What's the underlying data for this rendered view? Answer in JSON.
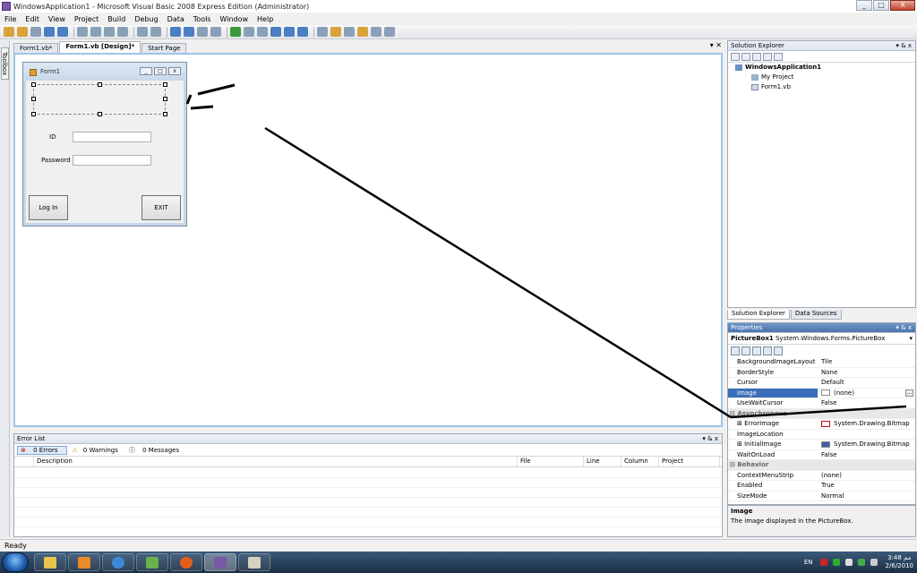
{
  "window": {
    "title": "WindowsApplication1 - Microsoft Visual Basic 2008 Express Edition (Administrator)",
    "controls": [
      "_",
      "□",
      "X"
    ]
  },
  "menu": [
    "File",
    "Edit",
    "View",
    "Project",
    "Build",
    "Debug",
    "Data",
    "Tools",
    "Window",
    "Help"
  ],
  "toolbox": {
    "label": "Toolbox"
  },
  "doc_tabs": [
    {
      "label": "Form1.vb*",
      "active": false
    },
    {
      "label": "Form1.vb [Design]*",
      "active": true
    },
    {
      "label": "Start Page",
      "active": false
    }
  ],
  "doc_tab_controls": "▾ ✕",
  "form": {
    "title": "Form1",
    "id_label": "ID",
    "password_label": "Password",
    "login_button": "Log In",
    "exit_button": "EXIT"
  },
  "solution_explorer": {
    "title": "Solution Explorer",
    "controls": "▾ & x",
    "items": [
      {
        "label": "WindowsApplication1",
        "level": 1
      },
      {
        "label": "My Project",
        "level": 2
      },
      {
        "label": "Form1.vb",
        "level": 2
      }
    ],
    "tabs": [
      "Solution Explorer",
      "Data Sources"
    ]
  },
  "properties": {
    "title": "Properties",
    "controls": "▾ & x",
    "object_name": "PictureBox1",
    "object_type": "System.Windows.Forms.PictureBox",
    "rows": [
      {
        "name": "BackgroundImageLayout",
        "value": "Tile"
      },
      {
        "name": "BorderStyle",
        "value": "None"
      },
      {
        "name": "Cursor",
        "value": "Default"
      },
      {
        "name": "Image",
        "value": "(none)",
        "selected": true
      },
      {
        "name": "UseWaitCursor",
        "value": "False"
      },
      {
        "name": "Asynchronous",
        "value": "",
        "category": true
      },
      {
        "name": "ErrorImage",
        "value": "System.Drawing.Bitmap"
      },
      {
        "name": "ImageLocation",
        "value": ""
      },
      {
        "name": "InitialImage",
        "value": "System.Drawing.Bitmap"
      },
      {
        "name": "WaitOnLoad",
        "value": "False"
      },
      {
        "name": "Behavior",
        "value": "",
        "category": true
      },
      {
        "name": "ContextMenuStrip",
        "value": "(none)"
      },
      {
        "name": "Enabled",
        "value": "True"
      },
      {
        "name": "SizeMode",
        "value": "Normal"
      }
    ],
    "description_title": "Image",
    "description_text": "The image displayed in the PictureBox."
  },
  "error_list": {
    "title": "Error List",
    "controls": "▾ & x",
    "errors": "0 Errors",
    "warnings": "0 Warnings",
    "messages": "0 Messages",
    "columns": [
      "",
      "Description",
      "File",
      "Line",
      "Column",
      "Project"
    ]
  },
  "status": "Ready",
  "tray": {
    "lang": "EN",
    "time": "3:48 مم",
    "date": "2/6/2010"
  }
}
